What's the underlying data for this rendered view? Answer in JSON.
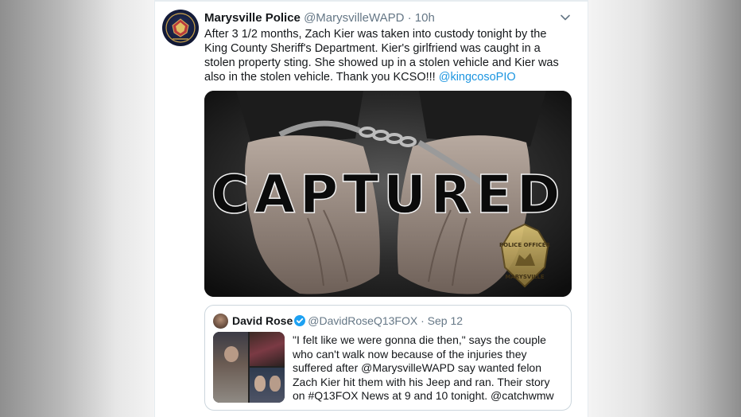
{
  "tweet": {
    "author_name": "Marysville Police",
    "author_handle": "@MarysvilleWAPD",
    "separator": "·",
    "time": "10h",
    "text_parts": {
      "body": "After 3 1/2 months, Zach Kier was taken into custody tonight by the King County Sheriff's Department.  Kier's girlfriend was caught in a stolen property sting.  She showed up in a stolen vehicle and Kier was also in the stolen vehicle.  Thank you KCSO!!! ",
      "mention": "@kingcosoPIO"
    },
    "avatar_icon": "police-badge-icon",
    "menu_icon": "chevron-down-icon"
  },
  "media": {
    "headline": "CAPTURED",
    "badge_top": "POLICE OFFICER",
    "badge_bottom": "MARYSVILLE"
  },
  "quote": {
    "author_name": "David Rose",
    "verified_icon": "verified-badge-icon",
    "author_handle": "@DavidRoseQ13FOX",
    "separator": "·",
    "date": "Sep 12",
    "text": "\"I felt like we were gonna die then,\" says the couple who can't walk now because of the injuries they suffered after @MarysvilleWAPD say wanted felon Zach Kier hit them with his Jeep and ran. Their story on #Q13FOX News at 9 and 10 tonight. @catchwmw"
  },
  "colors": {
    "link": "#1b95e0",
    "secondary_text": "#657786",
    "primary_text": "#14171a",
    "verified": "#1da1f2",
    "border": "#ccd6dd"
  }
}
